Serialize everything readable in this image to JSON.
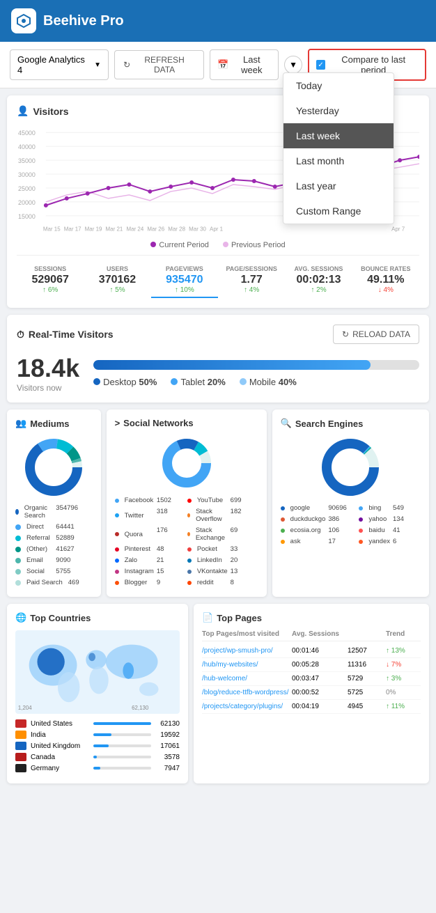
{
  "app": {
    "title": "Beehive Pro"
  },
  "toolbar": {
    "ga_selector": "Google Analytics 4",
    "refresh_label": "REFRESH DATA",
    "date_label": "Last week",
    "compare_label": "Compare to last period"
  },
  "dropdown": {
    "items": [
      {
        "label": "Today",
        "active": false
      },
      {
        "label": "Yesterday",
        "active": false
      },
      {
        "label": "Last week",
        "active": true
      },
      {
        "label": "Last month",
        "active": false
      },
      {
        "label": "Last year",
        "active": false
      },
      {
        "label": "Custom Range",
        "active": false
      }
    ]
  },
  "visitors_card": {
    "title": "Visitors",
    "legend_current": "Current Period",
    "legend_previous": "Previous Period"
  },
  "stats": [
    {
      "label": "SESSIONS",
      "value": "529067",
      "change": "↑ 6%",
      "up": true,
      "active": false
    },
    {
      "label": "USERS",
      "value": "370162",
      "change": "↑ 5%",
      "up": true,
      "active": false
    },
    {
      "label": "PAGEVIEWS",
      "value": "935470",
      "change": "↑ 10%",
      "up": true,
      "active": true
    },
    {
      "label": "PAGE/SESSIONS",
      "value": "1.77",
      "change": "↑ 4%",
      "up": true,
      "active": false
    },
    {
      "label": "AVG. SESSIONS",
      "value": "00:02:13",
      "change": "↑ 2%",
      "up": true,
      "active": false
    },
    {
      "label": "BOUNCE RATES",
      "value": "49.11%",
      "change": "↓ 4%",
      "up": false,
      "active": false
    }
  ],
  "realtime": {
    "title": "Real-Time Visitors",
    "reload_label": "RELOAD DATA",
    "count": "18.4k",
    "visitors_label": "Visitors now",
    "progress": 85,
    "devices": [
      {
        "label": "Desktop",
        "percent": "50%",
        "color": "#1565c0"
      },
      {
        "label": "Tablet",
        "percent": "20%",
        "color": "#42a5f5"
      },
      {
        "label": "Mobile",
        "percent": "40%",
        "color": "#90caf9"
      }
    ]
  },
  "mediums": {
    "title": "Mediums",
    "stats": [
      {
        "label": "Organic Search",
        "value": "354796",
        "color": "#1565c0"
      },
      {
        "label": "Direct",
        "value": "64441",
        "color": "#42a5f5"
      },
      {
        "label": "Referral",
        "value": "52889",
        "color": "#00bcd4"
      },
      {
        "label": "(Other)",
        "value": "41627",
        "color": "#009688"
      },
      {
        "label": "Email",
        "value": "9090",
        "color": "#4db6ac"
      },
      {
        "label": "Social",
        "value": "5755",
        "color": "#80cbc4"
      },
      {
        "label": "Paid Search",
        "value": "469",
        "color": "#b2dfdb"
      }
    ]
  },
  "social": {
    "title": "Social Networks",
    "stats": [
      {
        "label": "Facebook",
        "value": "1502"
      },
      {
        "label": "YouTube",
        "value": "699"
      },
      {
        "label": "Twitter",
        "value": "318"
      },
      {
        "label": "Stack Overflow",
        "value": "182"
      },
      {
        "label": "Quora",
        "value": "176"
      },
      {
        "label": "Stack Exchange",
        "value": "69"
      },
      {
        "label": "Pinterest",
        "value": "48"
      },
      {
        "label": "Pocket",
        "value": "33"
      },
      {
        "label": "Zalo",
        "value": "21"
      },
      {
        "label": "LinkedIn",
        "value": "20"
      },
      {
        "label": "Instagram",
        "value": "15"
      },
      {
        "label": "VKontakte",
        "value": "13"
      },
      {
        "label": "Blogger",
        "value": "9"
      },
      {
        "label": "reddit",
        "value": "8"
      }
    ]
  },
  "search_engines": {
    "title": "Search Engines",
    "stats": [
      {
        "label": "google",
        "value": "90696",
        "color": "#1565c0"
      },
      {
        "label": "bing",
        "value": "549",
        "color": "#42a5f5"
      },
      {
        "label": "duckduckgo",
        "value": "386",
        "color": "#00bcd4"
      },
      {
        "label": "yahoo",
        "value": "134",
        "color": "#009688"
      },
      {
        "label": "ecosia.org",
        "value": "106",
        "color": "#4db6ac"
      },
      {
        "label": "baidu",
        "value": "41",
        "color": "#80cbc4"
      },
      {
        "label": "ask",
        "value": "17",
        "color": "#b2dfdb"
      },
      {
        "label": "yandex",
        "value": "6",
        "color": "#e0f2f1"
      }
    ]
  },
  "top_countries": {
    "title": "Top Countries",
    "countries": [
      {
        "name": "United States",
        "value": "62130",
        "pct": 100,
        "color": "#c62828"
      },
      {
        "name": "India",
        "value": "19592",
        "pct": 32,
        "color": "#ff8f00"
      },
      {
        "name": "United Kingdom",
        "value": "17061",
        "pct": 27,
        "color": "#1565c0"
      },
      {
        "name": "Canada",
        "value": "3578",
        "pct": 6,
        "color": "#b71c1c"
      },
      {
        "name": "Germany",
        "value": "7947",
        "pct": 13,
        "color": "#212121"
      }
    ],
    "map_label": "1,204",
    "map_label2": "62,130"
  },
  "top_pages": {
    "title": "Top Pages",
    "headers": [
      "Top Pages/most visited",
      "Avg. Sessions",
      "",
      "Trend"
    ],
    "rows": [
      {
        "url": "/project/wp-smush-pro/",
        "sessions": "00:01:46",
        "count": "12507",
        "change": "↑ 13%",
        "up": true
      },
      {
        "url": "/hub/my-websites/",
        "sessions": "00:05:28",
        "count": "11316",
        "change": "↓ 7%",
        "up": false
      },
      {
        "url": "/hub-welcome/",
        "sessions": "00:03:47",
        "count": "5729",
        "change": "↑ 3%",
        "up": true
      },
      {
        "url": "/blog/reduce-ttfb-wordpress/",
        "sessions": "00:00:52",
        "count": "5725",
        "change": "0%",
        "up": null
      },
      {
        "url": "/projects/category/plugins/",
        "sessions": "00:04:19",
        "count": "4945",
        "change": "↑ 11%",
        "up": true
      }
    ]
  }
}
